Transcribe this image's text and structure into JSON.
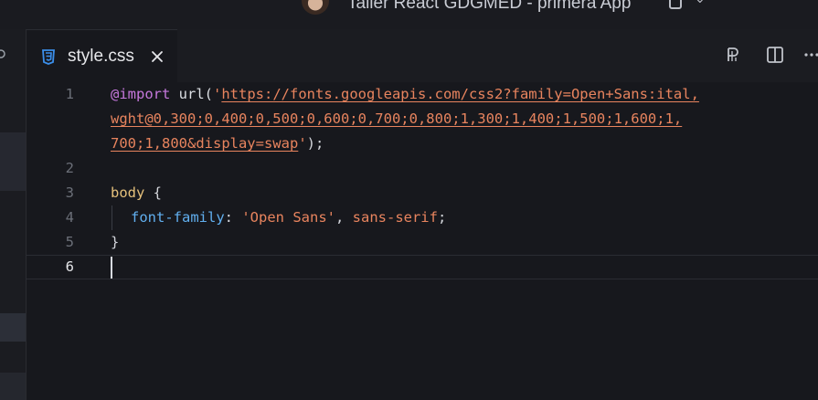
{
  "window": {
    "title": "Taller React GDGMED - primera App"
  },
  "tab": {
    "filename": "style.css"
  },
  "editor": {
    "line_numbers": [
      "1",
      "2",
      "3",
      "4",
      "5",
      "6"
    ],
    "active_line": "6",
    "lines": {
      "l1_kw": "@import",
      "l1_fn": " url(",
      "l1_q1": "'",
      "l1_url_a": "https://fonts.googleapis.com/css2?family=Open+Sans:ital,",
      "l1_url_b": "wght@0,300;0,400;0,500;0,600;0,700;0,800;1,300;1,400;1,500;1,600;1,",
      "l1_url_c": "700;1,800&display=swap",
      "l1_q2": "'",
      "l1_end": ");",
      "l3_sel": "body",
      "l3_brace": " {",
      "l4_prop": "font-family",
      "l4_colon": ": ",
      "l4_str": "'Open Sans'",
      "l4_comma": ", ",
      "l4_val": "sans-serif",
      "l4_semi": ";",
      "l5_brace": "}"
    }
  },
  "colors": {
    "background": "#17181d",
    "keyword": "#c678dd",
    "string": "#e8845e",
    "selector": "#e5c07b",
    "property": "#61afef",
    "css_icon": "#3b8eea"
  },
  "icons": {
    "tab_icon": "css-file-icon",
    "tab_close": "close-icon",
    "toolbar": [
      "preview-icon",
      "split-editor-icon",
      "more-actions-icon"
    ],
    "title": [
      "avatar",
      "lock-icon",
      "chevron-down-icon"
    ]
  }
}
